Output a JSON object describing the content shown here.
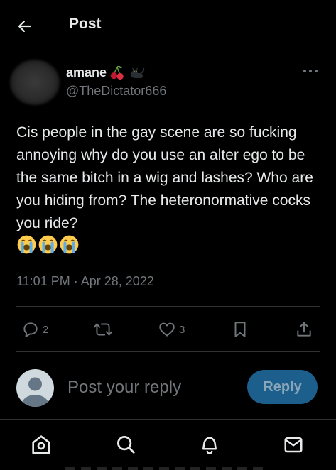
{
  "header": {
    "title": "Post"
  },
  "author": {
    "display_name": "amane",
    "name_emojis": [
      "cherries-emoji",
      "black-cat-emoji"
    ],
    "handle": "@TheDictator666"
  },
  "tweet": {
    "text": "Cis people in the gay scene are so fucking annoying why do you use an alter ego to be the same bitch in a wig and lashes? Who are you hiding from? The heteronormative cocks you ride?",
    "emojis": [
      "loudly-crying-face-emoji",
      "loudly-crying-face-emoji",
      "loudly-crying-face-emoji"
    ],
    "timestamp": "11:01 PM · Apr 28, 2022"
  },
  "actions": {
    "replies": "2",
    "reposts": "",
    "likes": "3",
    "icons": [
      "reply-icon",
      "repost-icon",
      "like-icon",
      "bookmark-icon",
      "share-icon"
    ]
  },
  "reply_box": {
    "placeholder": "Post your reply",
    "button_label": "Reply"
  },
  "bottom_nav": {
    "icons": [
      "home-icon",
      "search-icon",
      "notifications-icon",
      "messages-icon"
    ]
  },
  "colors": {
    "background": "#000000",
    "text_primary": "#e7e9ea",
    "text_secondary": "#71767b",
    "divider": "#2f3336",
    "reply_button_bg": "#1d5f8c"
  }
}
